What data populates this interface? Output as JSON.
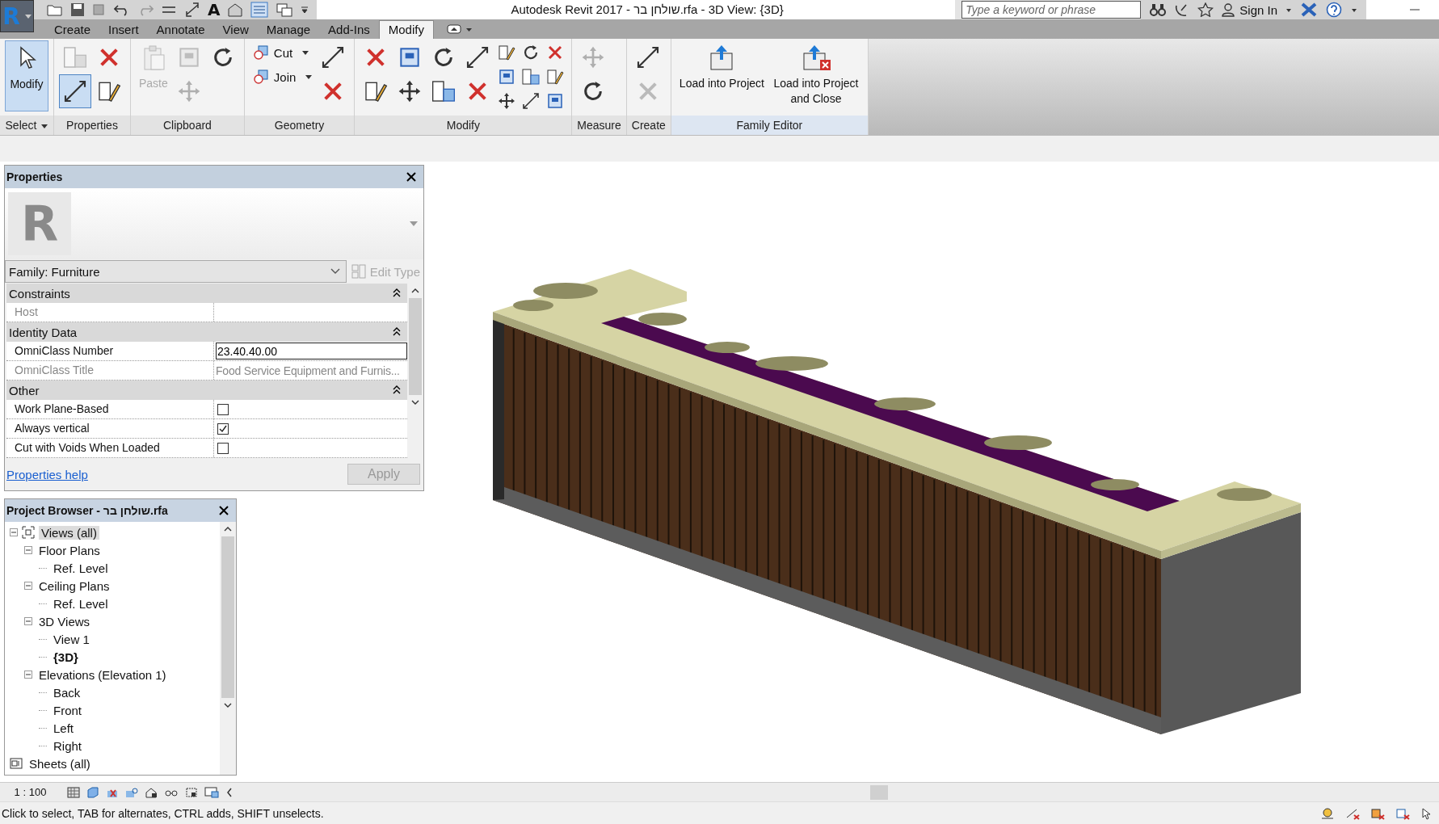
{
  "app_button": {
    "letter": "R"
  },
  "quick_access": {
    "text_tool_letter": "A"
  },
  "title": "Autodesk Revit 2017 - שולחן בר.rfa - 3D View: {3D}",
  "search": {
    "placeholder": "Type a keyword or phrase"
  },
  "sign_in": "Sign In",
  "tabs": [
    {
      "label": "Create",
      "selected": false
    },
    {
      "label": "Insert",
      "selected": false
    },
    {
      "label": "Annotate",
      "selected": false
    },
    {
      "label": "View",
      "selected": false
    },
    {
      "label": "Manage",
      "selected": false
    },
    {
      "label": "Add-Ins",
      "selected": false
    },
    {
      "label": "Modify",
      "selected": true
    }
  ],
  "ribbon_panels": [
    {
      "label": "Select",
      "dropdown": true,
      "tools": [
        {
          "kind": "large",
          "label": "Modify",
          "selected": true,
          "disabled": false
        }
      ]
    },
    {
      "label": "Properties",
      "dropdown": false,
      "tools": [
        {
          "kind": "icon",
          "selected": false,
          "disabled": true
        },
        {
          "kind": "icon",
          "selected": true,
          "disabled": false
        },
        {
          "kind": "icon",
          "selected": false,
          "disabled": false
        },
        {
          "kind": "icon",
          "selected": false,
          "disabled": false
        }
      ]
    },
    {
      "label": "Clipboard",
      "dropdown": false,
      "tools": [
        {
          "kind": "large",
          "label": "Paste",
          "selected": false,
          "disabled": true
        },
        {
          "kind": "icon",
          "selected": false,
          "disabled": true
        },
        {
          "kind": "icon",
          "selected": false,
          "disabled": true
        },
        {
          "kind": "icon",
          "selected": false,
          "disabled": false
        }
      ]
    },
    {
      "label": "Geometry",
      "dropdown": false,
      "tools": [
        {
          "kind": "labeled",
          "label": "Cut",
          "selected": false,
          "disabled": false
        },
        {
          "kind": "labeled",
          "label": "Join",
          "selected": false,
          "disabled": false
        },
        {
          "kind": "icon",
          "selected": false,
          "disabled": false
        },
        {
          "kind": "icon",
          "selected": false,
          "disabled": false
        }
      ]
    },
    {
      "label": "Modify",
      "dropdown": false,
      "tools": [
        {
          "kind": "icon",
          "selected": false,
          "disabled": false
        },
        {
          "kind": "icon",
          "selected": false,
          "disabled": false
        },
        {
          "kind": "icon",
          "selected": false,
          "disabled": false
        },
        {
          "kind": "icon",
          "selected": false,
          "disabled": false
        },
        {
          "kind": "icon",
          "selected": false,
          "disabled": false
        },
        {
          "kind": "icon",
          "selected": false,
          "disabled": false
        },
        {
          "kind": "icon",
          "selected": false,
          "disabled": false
        },
        {
          "kind": "icon",
          "selected": false,
          "disabled": false
        },
        {
          "kind": "mini",
          "selected": false,
          "disabled": false
        },
        {
          "kind": "mini",
          "selected": false,
          "disabled": false
        },
        {
          "kind": "mini",
          "selected": false,
          "disabled": false
        },
        {
          "kind": "mini",
          "selected": false,
          "disabled": false
        },
        {
          "kind": "mini",
          "selected": false,
          "disabled": false
        },
        {
          "kind": "mini",
          "selected": false,
          "disabled": false
        },
        {
          "kind": "mini",
          "selected": false,
          "disabled": false
        },
        {
          "kind": "mini",
          "selected": false,
          "disabled": false
        },
        {
          "kind": "mini",
          "selected": false,
          "disabled": false
        }
      ]
    },
    {
      "label": "Measure",
      "dropdown": false,
      "tools": [
        {
          "kind": "icon",
          "selected": false,
          "disabled": true
        },
        {
          "kind": "icon",
          "selected": false,
          "disabled": false
        }
      ]
    },
    {
      "label": "Create",
      "dropdown": false,
      "tools": [
        {
          "kind": "icon",
          "selected": false,
          "disabled": false
        },
        {
          "kind": "icon",
          "selected": false,
          "disabled": true
        }
      ]
    },
    {
      "label": "Family Editor",
      "dropdown": false,
      "tools": [
        {
          "kind": "large",
          "label": "Load into Project",
          "selected": false,
          "disabled": false
        },
        {
          "kind": "large",
          "label": "Load into Project and Close",
          "selected": false,
          "disabled": false
        }
      ]
    }
  ],
  "properties": {
    "title": "Properties",
    "type_image_letter": "R",
    "type_selector": "Family: Furniture",
    "edit_type": {
      "label": "Edit Type",
      "disabled": true
    },
    "groups": [
      {
        "name": "Constraints",
        "rows": [
          {
            "kind": "text",
            "label": "Host",
            "disabled": true
          }
        ]
      },
      {
        "name": "Identity Data",
        "rows": [
          {
            "kind": "field",
            "label": "OmniClass Number",
            "value": "23.40.40.00",
            "disabled": false
          },
          {
            "kind": "text",
            "label": "OmniClass Title",
            "value": "Food Service Equipment and Furnis...",
            "disabled": true
          }
        ]
      },
      {
        "name": "Other",
        "rows": [
          {
            "kind": "checkbox",
            "label": "Work Plane-Based",
            "checked": false,
            "disabled": false
          },
          {
            "kind": "checkbox",
            "label": "Always vertical",
            "checked": true,
            "disabled": false
          },
          {
            "kind": "checkbox",
            "label": "Cut with Voids When Loaded",
            "checked": false,
            "disabled": false
          }
        ]
      }
    ],
    "help_link": "Properties help",
    "apply": {
      "label": "Apply",
      "disabled": true
    }
  },
  "project_browser": {
    "title": "Project Browser - שולחן בר.rfa",
    "tree": [
      {
        "label": "Views (all)",
        "expanded": true,
        "selected": true,
        "current": false,
        "children": [
          {
            "label": "Floor Plans",
            "expanded": true,
            "selected": false,
            "current": false,
            "children": [
              {
                "label": "Ref. Level",
                "selected": false,
                "current": false
              }
            ]
          },
          {
            "label": "Ceiling Plans",
            "expanded": true,
            "selected": false,
            "current": false,
            "children": [
              {
                "label": "Ref. Level",
                "selected": false,
                "current": false
              }
            ]
          },
          {
            "label": "3D Views",
            "expanded": true,
            "selected": false,
            "current": false,
            "children": [
              {
                "label": "View 1",
                "selected": false,
                "current": false
              },
              {
                "label": "{3D}",
                "selected": false,
                "current": true
              }
            ]
          },
          {
            "label": "Elevations (Elevation 1)",
            "expanded": true,
            "selected": false,
            "current": false,
            "children": [
              {
                "label": "Back",
                "selected": false,
                "current": false
              },
              {
                "label": "Front",
                "selected": false,
                "current": false
              },
              {
                "label": "Left",
                "selected": false,
                "current": false
              },
              {
                "label": "Right",
                "selected": false,
                "current": false
              }
            ]
          }
        ]
      },
      {
        "label": "Sheets (all)",
        "selected": false,
        "current": false
      }
    ]
  },
  "view_control": {
    "scale": "1 : 100"
  },
  "status_bar": {
    "message": "Click to select, TAB for alternates, CTRL adds, SHIFT unselects."
  }
}
